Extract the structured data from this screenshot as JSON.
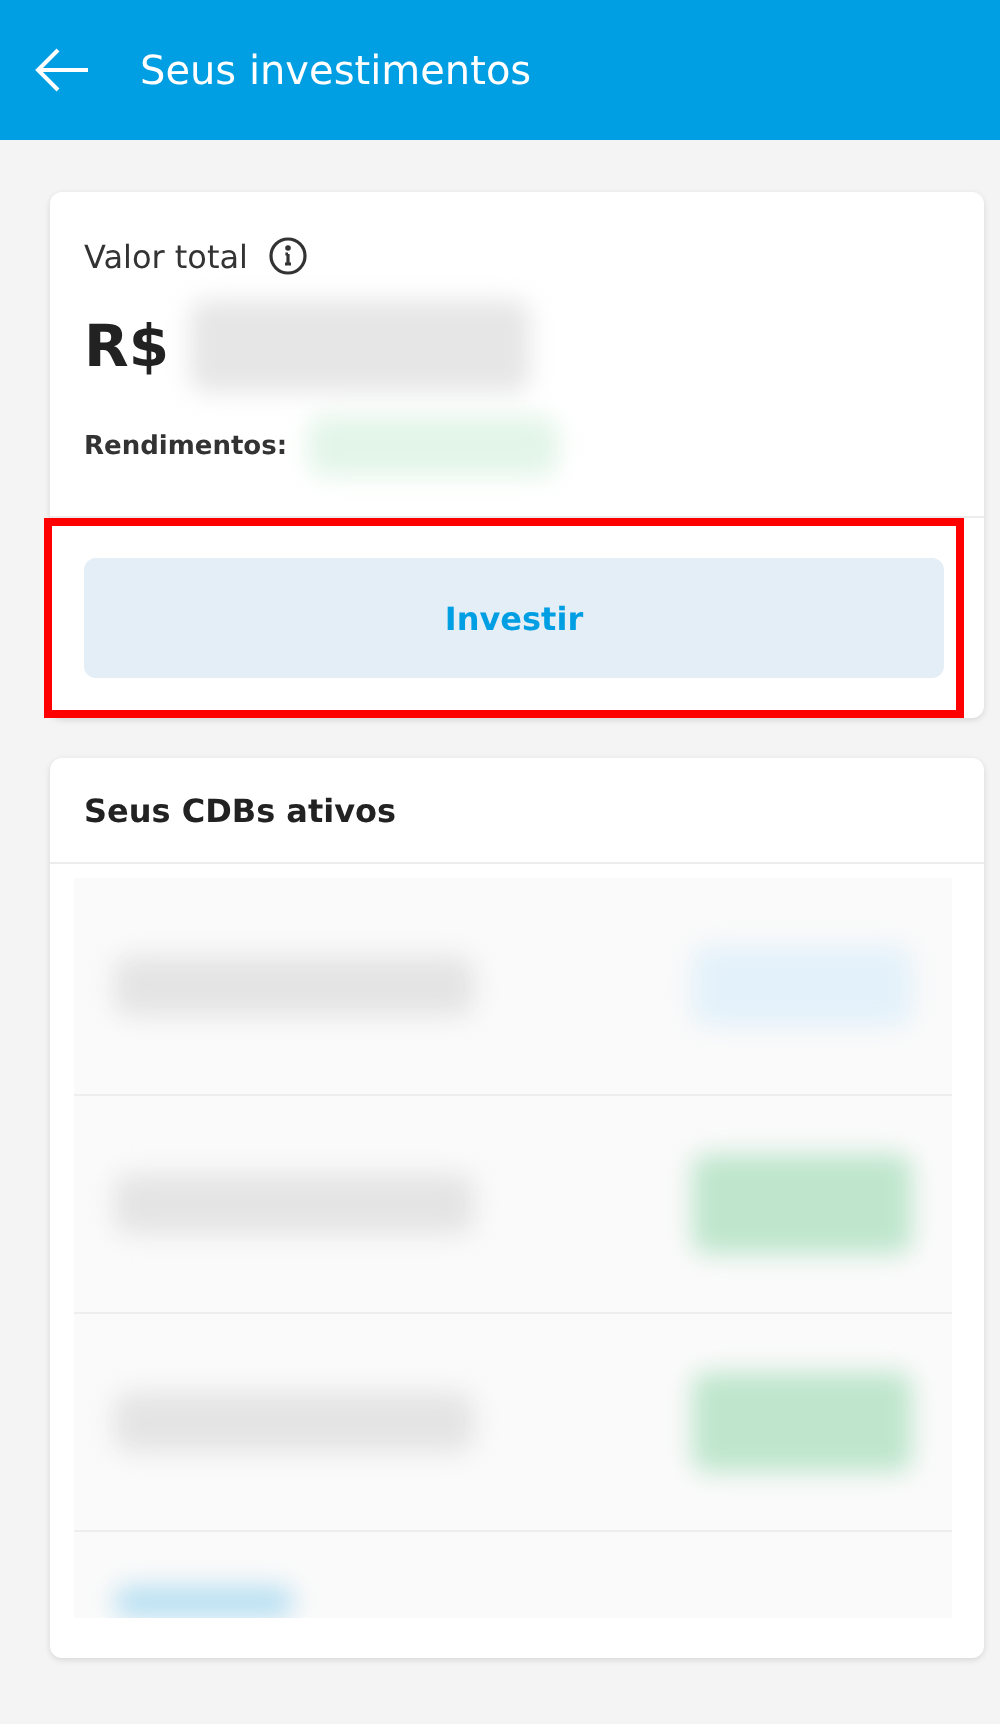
{
  "app_bar": {
    "title": "Seus investimentos"
  },
  "summary": {
    "label": "Valor total",
    "amount_prefix": "R$",
    "earnings_label": "Rendimentos:",
    "button": "Investir",
    "highlighted": true
  },
  "cdb_list": {
    "title": "Seus CDBs ativos",
    "rows": [
      {
        "kind": "pending"
      },
      {
        "kind": "earning"
      },
      {
        "kind": "earning"
      },
      {
        "kind": "footer"
      }
    ]
  }
}
